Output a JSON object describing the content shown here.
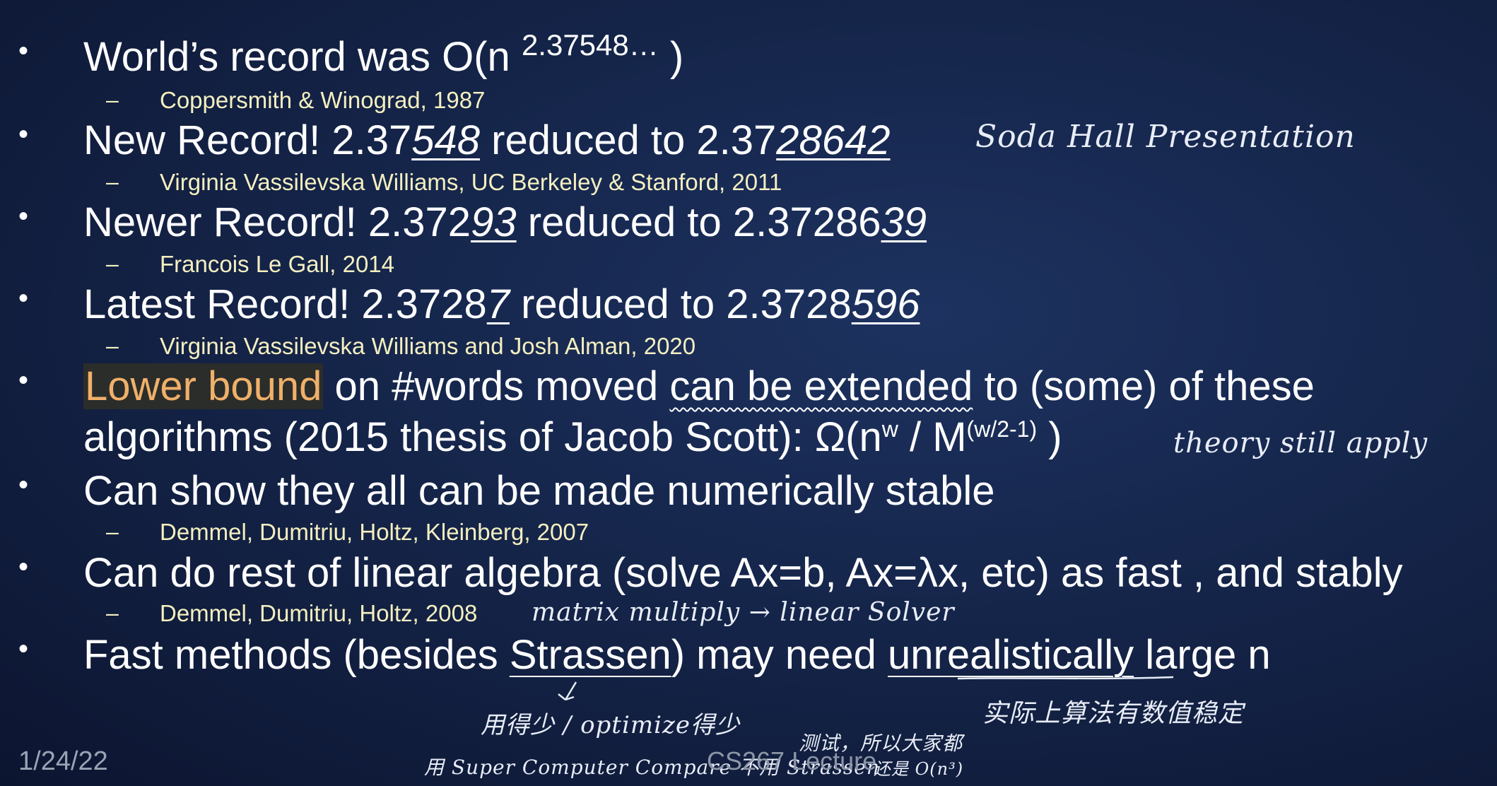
{
  "bullets": [
    {
      "pre": "World’s record was O(n ",
      "sup": "2.37548…",
      "post": " )",
      "sub": "Coppersmith & Winograd, 1987"
    },
    {
      "pre": "New Record! 2.37",
      "ital1": "548",
      "mid": " reduced to 2.37",
      "ital2": "28642",
      "sub": "Virginia Vassilevska Williams, UC Berkeley & Stanford, 2011"
    },
    {
      "pre": "Newer Record! 2.372",
      "ital1": "93",
      "mid": " reduced to 2.37286",
      "ital2": "39",
      "sub": "Francois Le Gall, 2014"
    },
    {
      "pre": "Latest Record! 2.3728",
      "ital1": "7",
      "mid": " reduced to 2.3728",
      "ital2": "596",
      "sub": "Virginia Vassilevska Williams and Josh Alman, 2020"
    },
    {
      "highlight": "Lower bound",
      "a": " on #words moved ",
      "underlined": "can be extended",
      "b": " to (some) of these",
      "line2_pre": "algorithms (2015 thesis of Jacob Scott):  Ω(n",
      "line2_sup1": "w",
      "line2_mid": " / M",
      "line2_sup2": "(w/2-1)",
      "line2_post": " )"
    },
    {
      "text": "Can show they all can be made numerically stable",
      "sub": "Demmel, Dumitriu, Holtz, Kleinberg, 2007"
    },
    {
      "text": "Can do rest of linear algebra (solve Ax=b, Ax=λx, etc) as fast , and stably",
      "sub": "Demmel, Dumitriu, Holtz, 2008"
    },
    {
      "pre": "Fast methods (besides ",
      "strassen": "Strassen",
      "mid": ") may need ",
      "unreal": "unrealistically",
      "post": " large n"
    }
  ],
  "bullet_glyph": "•",
  "dash_glyph": "–",
  "handwriting": {
    "soda": "Soda Hall Presentation",
    "theory": "theory still apply",
    "matrix": "matrix multiply → linear Solver",
    "cn_right": "实际上算法有数值稳定",
    "cn_left": "用得少 / optimize得少",
    "cn_mid": "测试，所以大家都",
    "cn_bottom_a": "用 Super Computer Compare 不用 Strassen",
    "cn_bottom_b": "还是 O(n³)"
  },
  "footer": {
    "date": "1/24/22",
    "title": "CS267 Lecture"
  },
  "colors": {
    "subtext": "#f4efc0",
    "highlight": "#f0b06a",
    "background": "#15254a"
  }
}
